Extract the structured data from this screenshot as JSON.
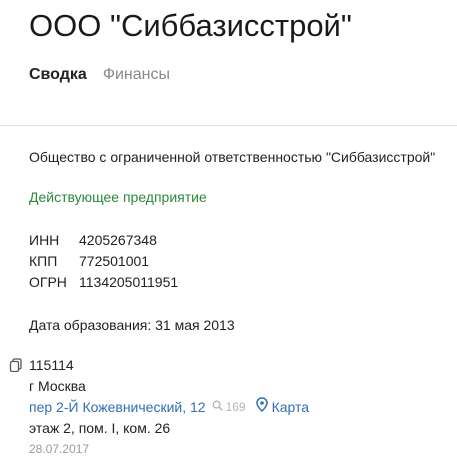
{
  "company": {
    "title": "ООО \"Сиббазисстрой\"",
    "full_name": "Общество с ограниченной ответственностью \"Сиббазисстрой\"",
    "status": "Действующее предприятие"
  },
  "tabs": [
    {
      "label": "Сводка",
      "active": true
    },
    {
      "label": "Финансы",
      "active": false
    }
  ],
  "identifiers": [
    {
      "label": "ИНН",
      "value": "4205267348"
    },
    {
      "label": "КПП",
      "value": "772501001"
    },
    {
      "label": "ОГРН",
      "value": "1134205011951"
    }
  ],
  "founded": "Дата образования: 31 мая 2013",
  "address": {
    "postal_code": "115114",
    "city": "г Москва",
    "street": "пер 2-Й Кожевнический, 12",
    "search_count": "169",
    "map_label": "Карта",
    "details": "этаж 2, пом. I, ком. 26",
    "date": "28.07.2017"
  },
  "colors": {
    "status": "#2a8a3a",
    "link": "#2f6fb6",
    "muted": "#8a8a8a"
  },
  "icons": [
    "copy-icon",
    "search-icon",
    "map-pin-icon"
  ]
}
